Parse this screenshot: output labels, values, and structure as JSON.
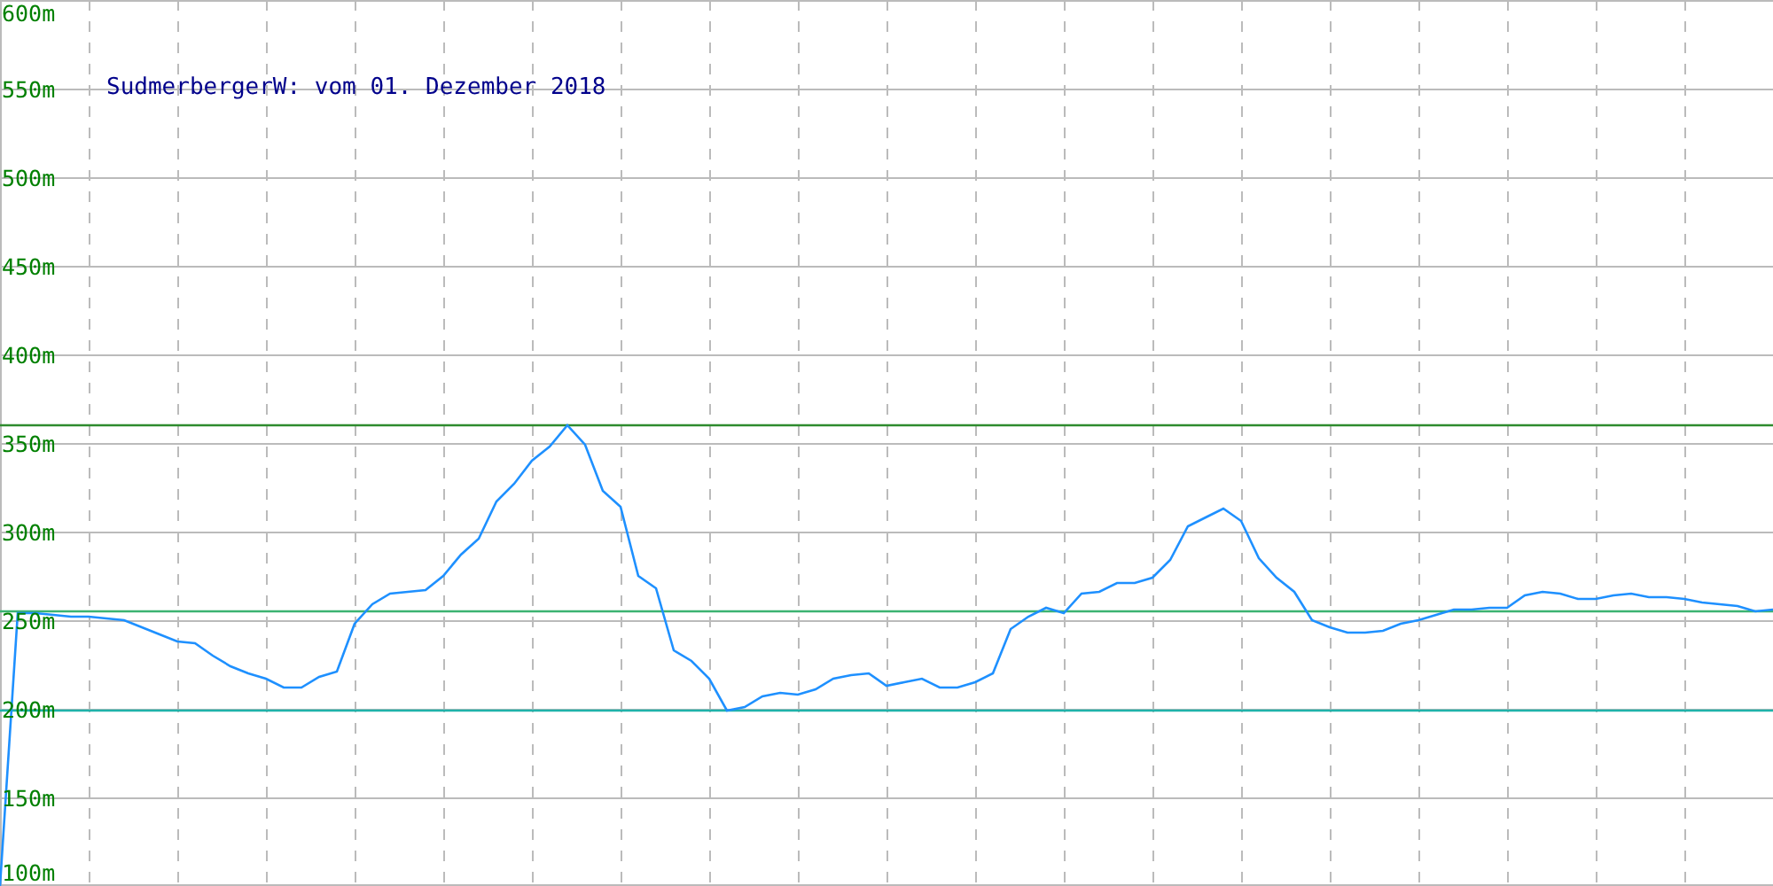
{
  "chart_data": {
    "type": "line",
    "title": "SudmerbergerW: vom 01. Dezember 2018",
    "ylim": [
      100,
      600
    ],
    "yticks": [
      {
        "value": 100,
        "label": "100m"
      },
      {
        "value": 150,
        "label": "150m"
      },
      {
        "value": 200,
        "label": "200m"
      },
      {
        "value": 250,
        "label": "250m"
      },
      {
        "value": 300,
        "label": "300m"
      },
      {
        "value": 350,
        "label": "350m"
      },
      {
        "value": 400,
        "label": "400m"
      },
      {
        "value": 450,
        "label": "450m"
      },
      {
        "value": 500,
        "label": "500m"
      },
      {
        "value": 550,
        "label": "550m"
      },
      {
        "value": 600,
        "label": "600m"
      }
    ],
    "categories": [
      null,
      null,
      null,
      null,
      null,
      null,
      null,
      null,
      null,
      null,
      null,
      null,
      null,
      null,
      null,
      null,
      null,
      null,
      null,
      null,
      null,
      null,
      null,
      null,
      null,
      null,
      null,
      null,
      null,
      null,
      null,
      null,
      null,
      null,
      null,
      null,
      null,
      null,
      null,
      null,
      null,
      null,
      null,
      null,
      null,
      null,
      null,
      null,
      null,
      null,
      null,
      null,
      null,
      null,
      null,
      null,
      null,
      null,
      null,
      null,
      null,
      null,
      null,
      null,
      null,
      null,
      null,
      null,
      null,
      null,
      null,
      null,
      null,
      null,
      null,
      null,
      null,
      null,
      null,
      null,
      null,
      null,
      null,
      null,
      null,
      null,
      null,
      null,
      null,
      null,
      null,
      null,
      null,
      null,
      null,
      null,
      null,
      null,
      null,
      null,
      null
    ],
    "series": [
      {
        "color": "#1e90ff",
        "values": [
          100,
          254,
          254,
          253,
          252,
          252,
          251,
          250,
          246,
          242,
          238,
          237,
          230,
          224,
          220,
          217,
          212,
          212,
          218,
          221,
          248,
          259,
          265,
          266,
          267,
          275,
          287,
          296,
          317,
          327,
          340,
          348,
          360,
          349,
          323,
          314,
          275,
          268,
          233,
          227,
          217,
          199,
          201,
          207,
          209,
          208,
          211,
          217,
          219,
          220,
          213,
          215,
          217,
          212,
          212,
          215,
          220,
          245,
          252,
          257,
          254,
          265,
          266,
          271,
          271,
          274,
          284,
          303,
          308,
          313,
          306,
          285,
          274,
          266,
          250,
          246,
          243,
          243,
          244,
          248,
          250,
          253,
          256,
          256,
          257,
          257,
          264,
          266,
          265,
          262,
          262,
          264,
          265,
          263,
          263,
          262,
          260,
          259,
          258,
          255,
          256
        ]
      },
      {
        "color": "#2e8b2e",
        "values": [
          360,
          360,
          360,
          360,
          360,
          360,
          360,
          360,
          360,
          360,
          360,
          360,
          360,
          360,
          360,
          360,
          360,
          360,
          360,
          360,
          360,
          360,
          360,
          360,
          360,
          360,
          360,
          360,
          360,
          360,
          360,
          360,
          360,
          360,
          360,
          360,
          360,
          360,
          360,
          360,
          360,
          360,
          360,
          360,
          360,
          360,
          360,
          360,
          360,
          360,
          360,
          360,
          360,
          360,
          360,
          360,
          360,
          360,
          360,
          360,
          360,
          360,
          360,
          360,
          360,
          360,
          360,
          360,
          360,
          360,
          360,
          360,
          360,
          360,
          360,
          360,
          360,
          360,
          360,
          360,
          360,
          360,
          360,
          360,
          360,
          360,
          360,
          360,
          360,
          360,
          360,
          360,
          360,
          360,
          360,
          360,
          360,
          360,
          360,
          360,
          360
        ]
      },
      {
        "color": "#3cb371",
        "values": [
          255,
          255,
          255,
          255,
          255,
          255,
          255,
          255,
          255,
          255,
          255,
          255,
          255,
          255,
          255,
          255,
          255,
          255,
          255,
          255,
          255,
          255,
          255,
          255,
          255,
          255,
          255,
          255,
          255,
          255,
          255,
          255,
          255,
          255,
          255,
          255,
          255,
          255,
          255,
          255,
          255,
          255,
          255,
          255,
          255,
          255,
          255,
          255,
          255,
          255,
          255,
          255,
          255,
          255,
          255,
          255,
          255,
          255,
          255,
          255,
          255,
          255,
          255,
          255,
          255,
          255,
          255,
          255,
          255,
          255,
          255,
          255,
          255,
          255,
          255,
          255,
          255,
          255,
          255,
          255,
          255,
          255,
          255,
          255,
          255,
          255,
          255,
          255,
          255,
          255,
          255,
          255,
          255,
          255,
          255,
          255,
          255,
          255,
          255,
          255,
          255
        ]
      },
      {
        "color": "#20b2aa",
        "values": [
          199,
          199,
          199,
          199,
          199,
          199,
          199,
          199,
          199,
          199,
          199,
          199,
          199,
          199,
          199,
          199,
          199,
          199,
          199,
          199,
          199,
          199,
          199,
          199,
          199,
          199,
          199,
          199,
          199,
          199,
          199,
          199,
          199,
          199,
          199,
          199,
          199,
          199,
          199,
          199,
          199,
          199,
          199,
          199,
          199,
          199,
          199,
          199,
          199,
          199,
          199,
          199,
          199,
          199,
          199,
          199,
          199,
          199,
          199,
          199,
          199,
          199,
          199,
          199,
          199,
          199,
          199,
          199,
          199,
          199,
          199,
          199,
          199,
          199,
          199,
          199,
          199,
          199,
          199,
          199,
          199,
          199,
          199,
          199,
          199,
          199,
          199,
          199,
          199,
          199,
          199,
          199,
          199,
          199,
          199,
          199,
          199,
          199,
          199,
          199,
          199
        ]
      }
    ],
    "grid": true
  }
}
